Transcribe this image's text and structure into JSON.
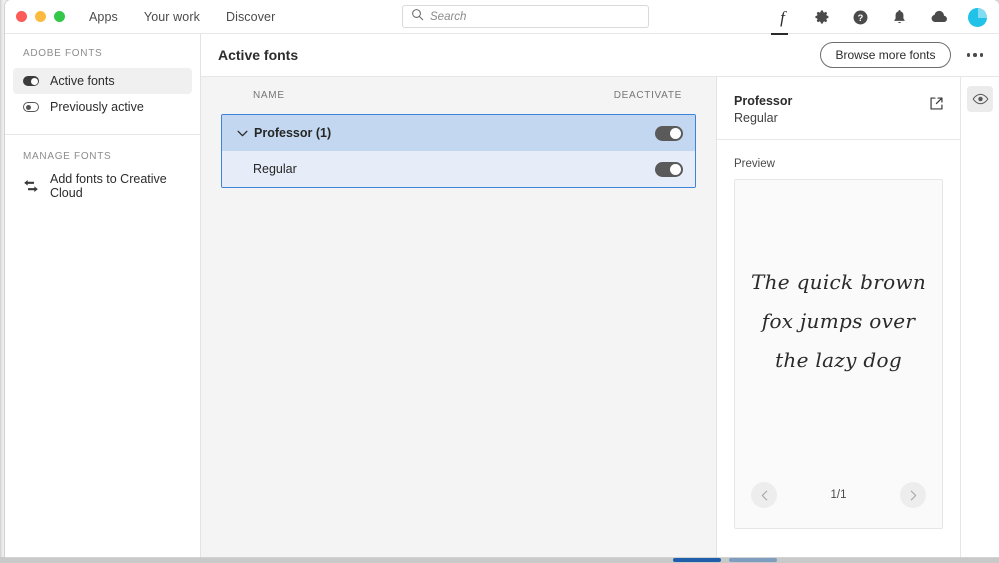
{
  "window": {
    "traffic_lights": [
      "close",
      "minimize",
      "zoom"
    ],
    "nav": [
      {
        "label": "Apps"
      },
      {
        "label": "Your work"
      },
      {
        "label": "Discover"
      }
    ],
    "search": {
      "placeholder": "Search",
      "value": ""
    },
    "toolbar_icons": [
      {
        "name": "fonts-icon",
        "glyph": "f",
        "active": true
      },
      {
        "name": "gear-icon",
        "glyph": "gear"
      },
      {
        "name": "help-icon",
        "glyph": "question"
      },
      {
        "name": "notifications-bell-icon",
        "glyph": "bell"
      },
      {
        "name": "cloud-sync-icon",
        "glyph": "cloud"
      },
      {
        "name": "avatar",
        "glyph": "avatar"
      }
    ],
    "avatar_color": "#21c2e8"
  },
  "sidebar": {
    "sections": [
      {
        "heading": "ADOBE FONTS",
        "items": [
          {
            "label": "Active fonts",
            "icon": "toggle-on-icon",
            "active": true
          },
          {
            "label": "Previously active",
            "icon": "toggle-off-icon",
            "active": false
          }
        ]
      },
      {
        "heading": "MANAGE FONTS",
        "items": [
          {
            "label": "Add fonts to Creative Cloud",
            "icon": "sync-arrows-icon",
            "active": false
          }
        ]
      }
    ]
  },
  "content": {
    "title": "Active fonts",
    "browse_button": "Browse more fonts",
    "more_options": "•••",
    "columns": {
      "name": "NAME",
      "deactivate": "DEACTIVATE"
    },
    "fonts": [
      {
        "name": "Professor (1)",
        "selected": true,
        "expanded": true,
        "toggle_on": true,
        "styles": [
          {
            "name": "Regular",
            "toggle_on": true
          }
        ]
      }
    ]
  },
  "detail": {
    "font_name": "Professor",
    "font_style": "Regular",
    "open_external_icon": "external-link-icon",
    "preview_label": "Preview",
    "preview_lines": [
      "The quick brown",
      "fox jumps over",
      "the lazy dog"
    ],
    "pager": {
      "prev": "‹",
      "count": "1/1",
      "next": "›"
    }
  },
  "rail": {
    "buttons": [
      {
        "name": "preview-eye-icon",
        "active": true
      }
    ]
  },
  "colors": {
    "selection_blue": "#3d83d6",
    "group_row_bg": "#c3d8f0",
    "child_row_bg": "#e6edf8",
    "list_bg": "#f4f4f4",
    "toggle_on": "#5a5a5a"
  }
}
